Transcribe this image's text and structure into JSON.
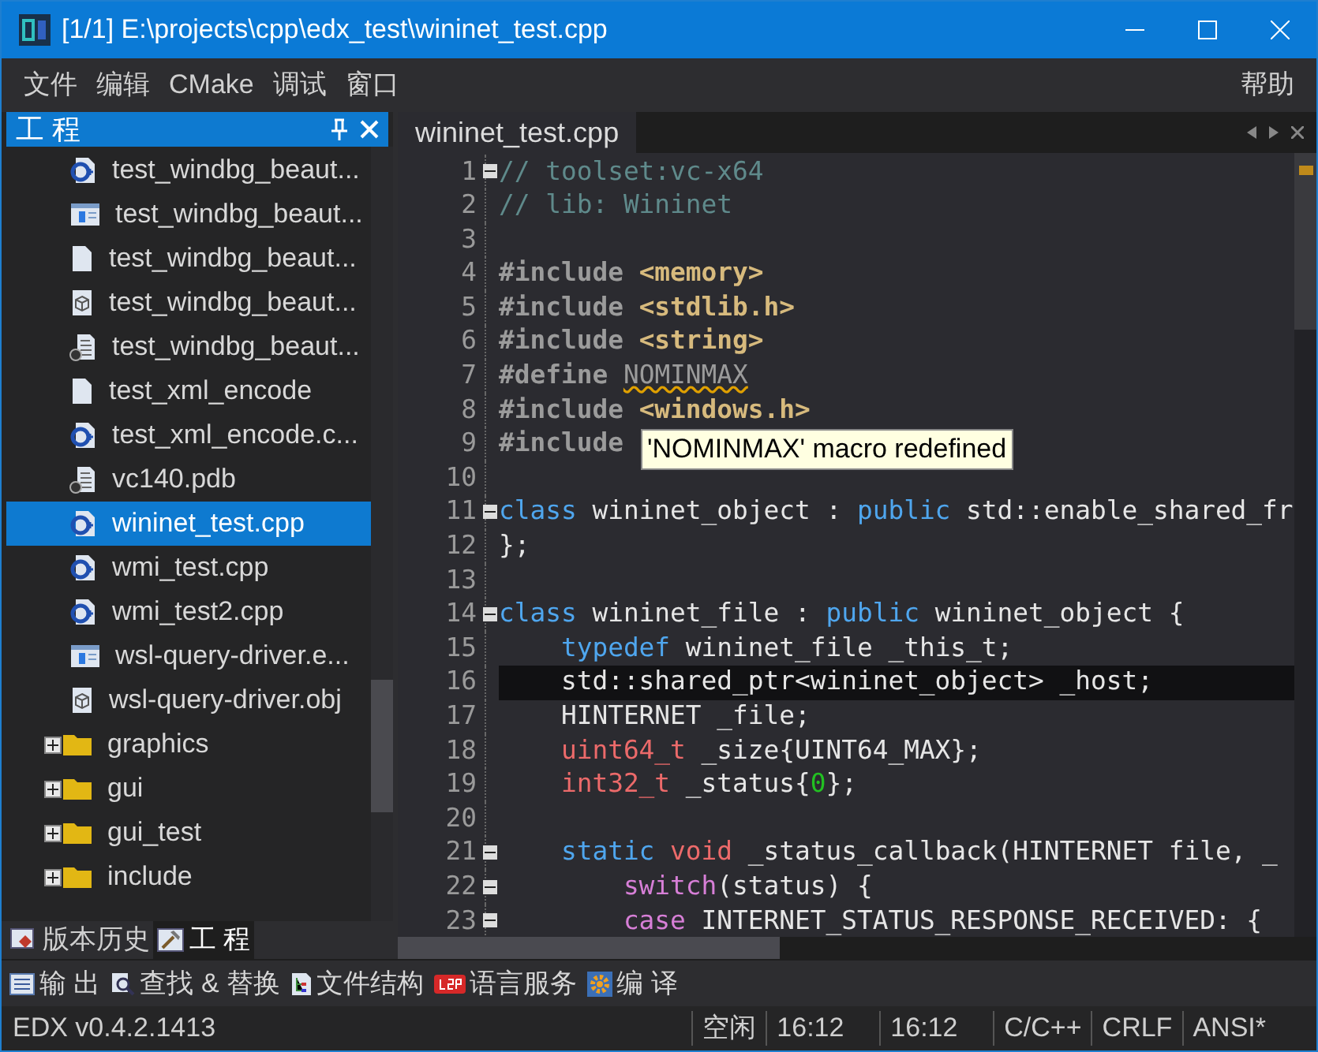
{
  "window": {
    "title": "[1/1] E:\\projects\\cpp\\edx_test\\wininet_test.cpp"
  },
  "menu": {
    "left": [
      "文件",
      "编辑",
      "CMake",
      "调试",
      "窗口"
    ],
    "right": [
      "帮助"
    ]
  },
  "project_panel": {
    "title": "工 程",
    "items": [
      {
        "label": "test_windbg_beaut...",
        "kind": "cpp",
        "selected": false
      },
      {
        "label": "test_windbg_beaut...",
        "kind": "exe",
        "selected": false
      },
      {
        "label": "test_windbg_beaut...",
        "kind": "blank",
        "selected": false
      },
      {
        "label": "test_windbg_beaut...",
        "kind": "obj",
        "selected": false
      },
      {
        "label": "test_windbg_beaut...",
        "kind": "pdb",
        "selected": false
      },
      {
        "label": "test_xml_encode",
        "kind": "blank",
        "selected": false
      },
      {
        "label": "test_xml_encode.c...",
        "kind": "cpp",
        "selected": false
      },
      {
        "label": "vc140.pdb",
        "kind": "pdb",
        "selected": false
      },
      {
        "label": "wininet_test.cpp",
        "kind": "cpp",
        "selected": true
      },
      {
        "label": "wmi_test.cpp",
        "kind": "cpp",
        "selected": false
      },
      {
        "label": "wmi_test2.cpp",
        "kind": "cpp",
        "selected": false
      },
      {
        "label": "wsl-query-driver.e...",
        "kind": "exe",
        "selected": false
      },
      {
        "label": "wsl-query-driver.obj",
        "kind": "obj",
        "selected": false
      },
      {
        "label": "graphics",
        "kind": "folder",
        "expanded": false,
        "selected": false
      },
      {
        "label": "gui",
        "kind": "folder",
        "expanded": false,
        "selected": false
      },
      {
        "label": "gui_test",
        "kind": "folder",
        "expanded": false,
        "selected": false
      },
      {
        "label": "include",
        "kind": "folder",
        "expanded": false,
        "selected": false
      }
    ],
    "tabs": [
      {
        "label": "版本历史",
        "kind": "history",
        "selected": false
      },
      {
        "label": "工 程",
        "kind": "project",
        "selected": true
      }
    ]
  },
  "editor": {
    "tab": "wininet_test.cpp",
    "lines": [
      {
        "number": "1",
        "foldable": true,
        "current": false,
        "tokens": [
          {
            "kind": "comment",
            "text": "// toolset:vc-x64"
          }
        ]
      },
      {
        "number": "2",
        "foldable": false,
        "current": false,
        "tokens": [
          {
            "kind": "comment",
            "text": "// lib: Wininet"
          }
        ]
      },
      {
        "number": "3",
        "foldable": false,
        "current": false
      },
      {
        "number": "4",
        "foldable": false,
        "current": false,
        "tokens": [
          {
            "kind": "pp",
            "text": "#include "
          },
          {
            "kind": "str",
            "text": "<memory>"
          }
        ]
      },
      {
        "number": "5",
        "foldable": false,
        "current": false,
        "tokens": [
          {
            "kind": "pp",
            "text": "#include "
          },
          {
            "kind": "str",
            "text": "<stdlib.h>"
          }
        ]
      },
      {
        "number": "6",
        "foldable": false,
        "current": false,
        "tokens": [
          {
            "kind": "pp",
            "text": "#include "
          },
          {
            "kind": "str",
            "text": "<string>"
          }
        ]
      },
      {
        "number": "7",
        "foldable": false,
        "current": false,
        "tokens": [
          {
            "kind": "pp",
            "text": "#define "
          },
          {
            "kind": "macro",
            "text": "NOMINMAX"
          }
        ]
      },
      {
        "number": "8",
        "foldable": false,
        "current": false,
        "tokens": [
          {
            "kind": "pp",
            "text": "#include "
          },
          {
            "kind": "str",
            "text": "<windows.h>"
          }
        ]
      },
      {
        "number": "9",
        "foldable": false,
        "current": false,
        "tokens": [
          {
            "kind": "pp",
            "text": "#include"
          }
        ]
      },
      {
        "number": "10",
        "foldable": false,
        "current": false
      },
      {
        "number": "11",
        "foldable": true,
        "current": false,
        "tokens": [
          {
            "kind": "kw",
            "text": "class"
          },
          {
            "kind": "plain",
            "text": " wininet_object : "
          },
          {
            "kind": "kw",
            "text": "public"
          },
          {
            "kind": "plain",
            "text": " std::enable_shared_fr"
          }
        ]
      },
      {
        "number": "12",
        "foldable": false,
        "current": false,
        "tokens": [
          {
            "kind": "plain",
            "text": "};"
          }
        ]
      },
      {
        "number": "13",
        "foldable": false,
        "current": false
      },
      {
        "number": "14",
        "foldable": true,
        "current": false,
        "tokens": [
          {
            "kind": "kw",
            "text": "class"
          },
          {
            "kind": "plain",
            "text": " wininet_file : "
          },
          {
            "kind": "kw",
            "text": "public"
          },
          {
            "kind": "plain",
            "text": " wininet_object {"
          }
        ]
      },
      {
        "number": "15",
        "foldable": false,
        "current": false,
        "tokens": [
          {
            "kind": "kw",
            "text": "    typedef"
          },
          {
            "kind": "plain",
            "text": " wininet_file _this_t;"
          }
        ]
      },
      {
        "number": "16",
        "foldable": false,
        "current": true,
        "tokens": [
          {
            "kind": "plain",
            "text": "    std::shared_ptr<wininet_object> _host;"
          }
        ]
      },
      {
        "number": "17",
        "foldable": false,
        "current": false,
        "tokens": [
          {
            "kind": "plain",
            "text": "    HINTERNET _file;"
          }
        ]
      },
      {
        "number": "18",
        "foldable": false,
        "current": false,
        "tokens": [
          {
            "kind": "type",
            "text": "    uint64_t"
          },
          {
            "kind": "plain",
            "text": " _size{UINT64_MAX};"
          }
        ]
      },
      {
        "number": "19",
        "foldable": false,
        "current": false,
        "tokens": [
          {
            "kind": "type",
            "text": "    int32_t"
          },
          {
            "kind": "plain",
            "text": " _status{"
          },
          {
            "kind": "num",
            "text": "0"
          },
          {
            "kind": "plain",
            "text": "};"
          }
        ]
      },
      {
        "number": "20",
        "foldable": false,
        "current": false
      },
      {
        "number": "21",
        "foldable": true,
        "current": false,
        "tokens": [
          {
            "kind": "kw",
            "text": "    static"
          },
          {
            "kind": "type",
            "text": " void"
          },
          {
            "kind": "plain",
            "text": " _status_callback(HINTERNET file, _"
          }
        ]
      },
      {
        "number": "22",
        "foldable": true,
        "current": false,
        "tokens": [
          {
            "kind": "ctl",
            "text": "        switch"
          },
          {
            "kind": "plain",
            "text": "(status) {"
          }
        ]
      },
      {
        "number": "23",
        "foldable": true,
        "current": false,
        "tokens": [
          {
            "kind": "ctl",
            "text": "        case"
          },
          {
            "kind": "plain",
            "text": " INTERNET_STATUS_RESPONSE_RECEIVED: {"
          }
        ]
      }
    ],
    "tooltip": "'NOMINMAX' macro redefined"
  },
  "toolbar": [
    {
      "label": "输 出",
      "kind": "output"
    },
    {
      "label": "查找 & 替换",
      "kind": "search"
    },
    {
      "label": "文件结构",
      "kind": "structure"
    },
    {
      "label": "语言服务",
      "kind": "lsp"
    },
    {
      "label": "编 译",
      "kind": "build"
    }
  ],
  "status_bar": {
    "version": "EDX v0.4.2.1413",
    "fields": [
      "空闲",
      "16:12",
      "16:12",
      "C/C++",
      "CRLF",
      "ANSI*"
    ]
  }
}
